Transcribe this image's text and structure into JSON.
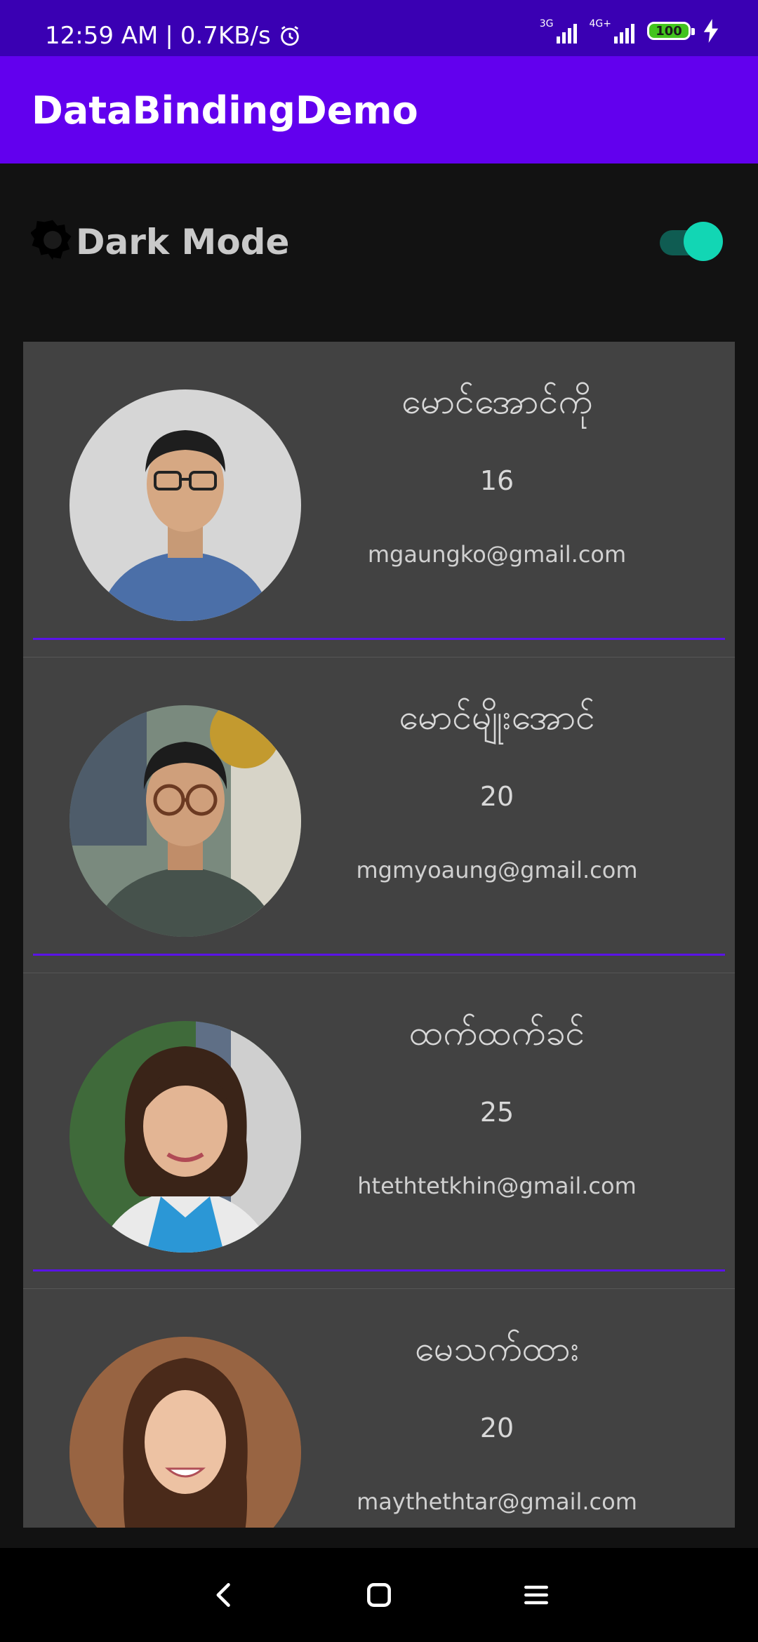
{
  "status_bar": {
    "time": "12:59 AM",
    "speed": "0.7KB/s",
    "network1": "3G",
    "network2": "4G+",
    "battery": "100",
    "icons": [
      "alarm-icon",
      "signal-icon",
      "battery-icon",
      "charging-bolt-icon"
    ]
  },
  "app_bar": {
    "title": "DataBindingDemo"
  },
  "dark_mode": {
    "label": "Dark Mode",
    "icon": "brightness-icon",
    "enabled": true
  },
  "users": [
    {
      "name": "မောင်အောင်ကို",
      "age": "16",
      "email": "mgaungko@gmail.com"
    },
    {
      "name": "မောင်မျိုးအောင်",
      "age": "20",
      "email": "mgmyoaung@gmail.com"
    },
    {
      "name": "ထက်ထက်ခင်",
      "age": "25",
      "email": "htethtetkhin@gmail.com"
    },
    {
      "name": "မေသက်ထား",
      "age": "20",
      "email": "maythethtar@gmail.com"
    }
  ],
  "nav": {
    "back": "back-icon",
    "home": "home-icon",
    "recents": "recents-icon"
  },
  "colors": {
    "app_bar": "#6200ee",
    "status_bar": "#3a00b3",
    "accent": "#12d6b4",
    "card": "#424242"
  }
}
